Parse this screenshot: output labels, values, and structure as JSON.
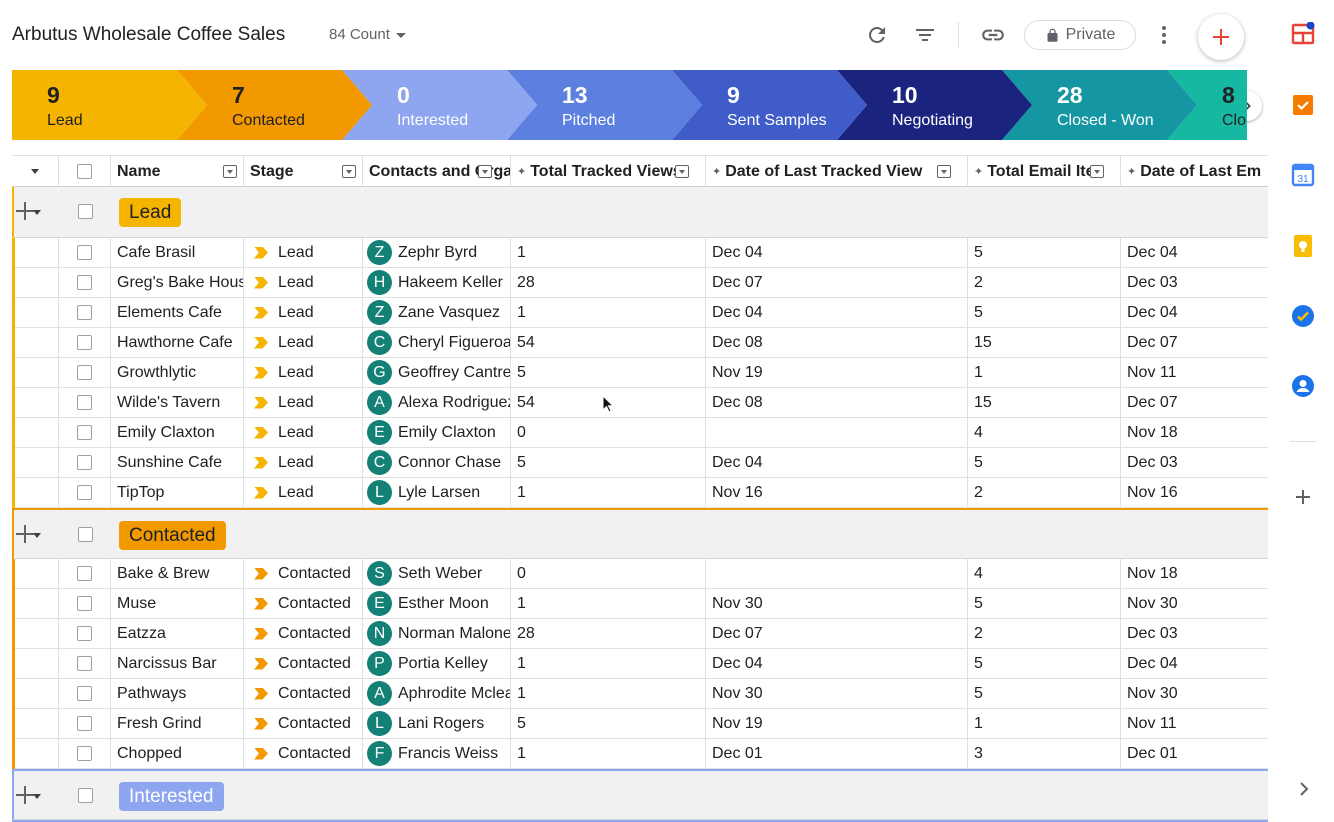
{
  "header": {
    "title": "Arbutus Wholesale Coffee Sales",
    "count_label": "84 Count",
    "private_label": "Private",
    "icons": [
      "refresh-icon",
      "filter-icon",
      "link-icon",
      "lock-icon",
      "more-vert-icon",
      "add-icon"
    ]
  },
  "pipeline": {
    "stages": [
      {
        "count": "9",
        "label": "Lead",
        "color": "#f4b400",
        "text": "#202124"
      },
      {
        "count": "7",
        "label": "Contacted",
        "color": "#f29900",
        "text": "#202124"
      },
      {
        "count": "0",
        "label": "Interested",
        "color": "#8ea5ef",
        "text": "#ffffff"
      },
      {
        "count": "13",
        "label": "Pitched",
        "color": "#5c7fe0",
        "text": "#ffffff"
      },
      {
        "count": "9",
        "label": "Sent Samples",
        "color": "#3f5cc9",
        "text": "#ffffff"
      },
      {
        "count": "10",
        "label": "Negotiating",
        "color": "#1a237e",
        "text": "#ffffff"
      },
      {
        "count": "28",
        "label": "Closed - Won",
        "color": "#1497a3",
        "text": "#ffffff"
      },
      {
        "count": "8",
        "label": "Clo",
        "color": "#17b8a2",
        "text": "#202124"
      }
    ]
  },
  "columns": {
    "name": "Name",
    "stage": "Stage",
    "contacts": "Contacts and Orga",
    "views": "Total Tracked Views",
    "last_view": "Date of Last Tracked View",
    "emails": "Total Email Ites",
    "last_email": "Date of Last Em"
  },
  "groups": [
    {
      "label": "Lead",
      "chip_color": "#f4b400",
      "accent": "#f4b400",
      "rows": [
        {
          "name": "Cafe Brasil",
          "stage": "Lead",
          "initial": "Z",
          "contact": "Zephr Byrd",
          "views": "1",
          "last_view": "Dec 04",
          "emails": "5",
          "last_email": "Dec 04"
        },
        {
          "name": "Greg's Bake House",
          "stage": "Lead",
          "initial": "H",
          "contact": "Hakeem Keller",
          "views": "28",
          "last_view": "Dec 07",
          "emails": "2",
          "last_email": "Dec 03"
        },
        {
          "name": "Elements Cafe",
          "stage": "Lead",
          "initial": "Z",
          "contact": "Zane Vasquez",
          "views": "1",
          "last_view": "Dec 04",
          "emails": "5",
          "last_email": "Dec 04"
        },
        {
          "name": "Hawthorne Cafe",
          "stage": "Lead",
          "initial": "C",
          "contact": "Cheryl Figueroa",
          "views": "54",
          "last_view": "Dec 08",
          "emails": "15",
          "last_email": "Dec 07"
        },
        {
          "name": "Growthlytic",
          "stage": "Lead",
          "initial": "G",
          "contact": "Geoffrey Cantrell",
          "views": "5",
          "last_view": "Nov 19",
          "emails": "1",
          "last_email": "Nov 11"
        },
        {
          "name": "Wilde's Tavern",
          "stage": "Lead",
          "initial": "A",
          "contact": "Alexa Rodriguez",
          "views": "54",
          "last_view": "Dec 08",
          "emails": "15",
          "last_email": "Dec 07"
        },
        {
          "name": "Emily Claxton",
          "stage": "Lead",
          "initial": "E",
          "contact": "Emily Claxton",
          "views": "0",
          "last_view": "",
          "emails": "4",
          "last_email": "Nov 18"
        },
        {
          "name": "Sunshine Cafe",
          "stage": "Lead",
          "initial": "C",
          "contact": "Connor Chase",
          "views": "5",
          "last_view": "Dec 04",
          "emails": "5",
          "last_email": "Dec 03"
        },
        {
          "name": "TipTop",
          "stage": "Lead",
          "initial": "L",
          "contact": "Lyle Larsen",
          "views": "1",
          "last_view": "Nov 16",
          "emails": "2",
          "last_email": "Nov 16"
        }
      ]
    },
    {
      "label": "Contacted",
      "chip_color": "#f29900",
      "accent": "#f29900",
      "rows": [
        {
          "name": "Bake & Brew",
          "stage": "Contacted",
          "initial": "S",
          "contact": "Seth Weber",
          "views": "0",
          "last_view": "",
          "emails": "4",
          "last_email": "Nov 18"
        },
        {
          "name": "Muse",
          "stage": "Contacted",
          "initial": "E",
          "contact": "Esther Moon",
          "views": "1",
          "last_view": "Nov 30",
          "emails": "5",
          "last_email": "Nov 30"
        },
        {
          "name": "Eatzza",
          "stage": "Contacted",
          "initial": "N",
          "contact": "Norman Malone",
          "views": "28",
          "last_view": "Dec 07",
          "emails": "2",
          "last_email": "Dec 03"
        },
        {
          "name": "Narcissus Bar",
          "stage": "Contacted",
          "initial": "P",
          "contact": "Portia Kelley",
          "views": "1",
          "last_view": "Dec 04",
          "emails": "5",
          "last_email": "Dec 04"
        },
        {
          "name": "Pathways",
          "stage": "Contacted",
          "initial": "A",
          "contact": "Aphrodite Mclean",
          "views": "1",
          "last_view": "Nov 30",
          "emails": "5",
          "last_email": "Nov 30"
        },
        {
          "name": "Fresh Grind",
          "stage": "Contacted",
          "initial": "L",
          "contact": "Lani Rogers",
          "views": "5",
          "last_view": "Nov 19",
          "emails": "1",
          "last_email": "Nov 11"
        },
        {
          "name": "Chopped",
          "stage": "Contacted",
          "initial": "F",
          "contact": "Francis Weiss",
          "views": "1",
          "last_view": "Dec 01",
          "emails": "3",
          "last_email": "Dec 01"
        }
      ]
    },
    {
      "label": "Interested",
      "chip_color": "#8ea5ef",
      "accent": "#8ea5ef",
      "rows": []
    }
  ],
  "side_panel": {
    "icons": [
      "apps-script-icon",
      "tasks-icon",
      "calendar-icon",
      "keep-icon",
      "tasks-check-icon",
      "contacts-icon",
      "add-icon",
      "expand-icon"
    ],
    "calendar_day": "31"
  }
}
